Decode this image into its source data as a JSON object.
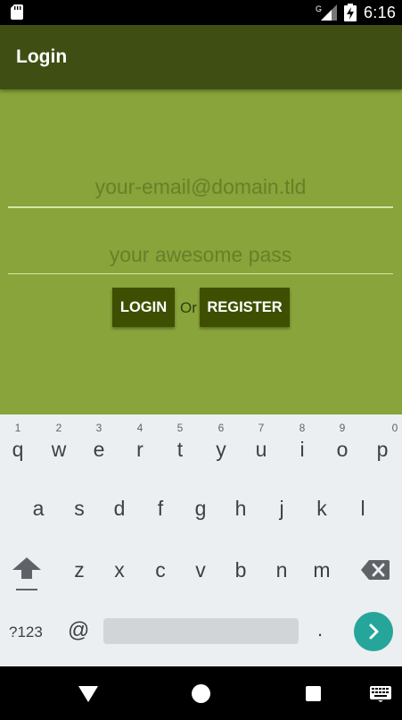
{
  "status_bar": {
    "time": "6:16",
    "network": "G",
    "icons": [
      "sd-card-icon",
      "signal-icon",
      "battery-charging-icon"
    ]
  },
  "app_bar": {
    "title": "Login"
  },
  "form": {
    "email_placeholder": "your-email@domain.tld",
    "email_value": "",
    "password_placeholder": "your awesome pass",
    "password_value": "",
    "login_label": "LOGIN",
    "or_text": "Or",
    "register_label": "REGISTER"
  },
  "keyboard": {
    "row1": [
      {
        "key": "q",
        "hint": "1"
      },
      {
        "key": "w",
        "hint": "2"
      },
      {
        "key": "e",
        "hint": "3"
      },
      {
        "key": "r",
        "hint": "4"
      },
      {
        "key": "t",
        "hint": "5"
      },
      {
        "key": "y",
        "hint": "6"
      },
      {
        "key": "u",
        "hint": "7"
      },
      {
        "key": "i",
        "hint": "8"
      },
      {
        "key": "o",
        "hint": "9"
      },
      {
        "key": "p",
        "hint": "0"
      }
    ],
    "row2": [
      "a",
      "s",
      "d",
      "f",
      "g",
      "h",
      "j",
      "k",
      "l"
    ],
    "row3": [
      "z",
      "x",
      "c",
      "v",
      "b",
      "n",
      "m"
    ],
    "symbols_label": "?123",
    "at_label": "@",
    "period_label": ".",
    "icons": [
      "shift-icon",
      "backspace-icon",
      "go-arrow-icon"
    ]
  },
  "colors": {
    "app_bar": "#3f4f13",
    "content_bg": "#88a43a",
    "button_bg": "#3f4f02",
    "go_button": "#26a69a"
  },
  "nav_bar": {
    "icons": [
      "back-icon",
      "home-icon",
      "recents-icon",
      "keyboard-switch-icon"
    ]
  }
}
